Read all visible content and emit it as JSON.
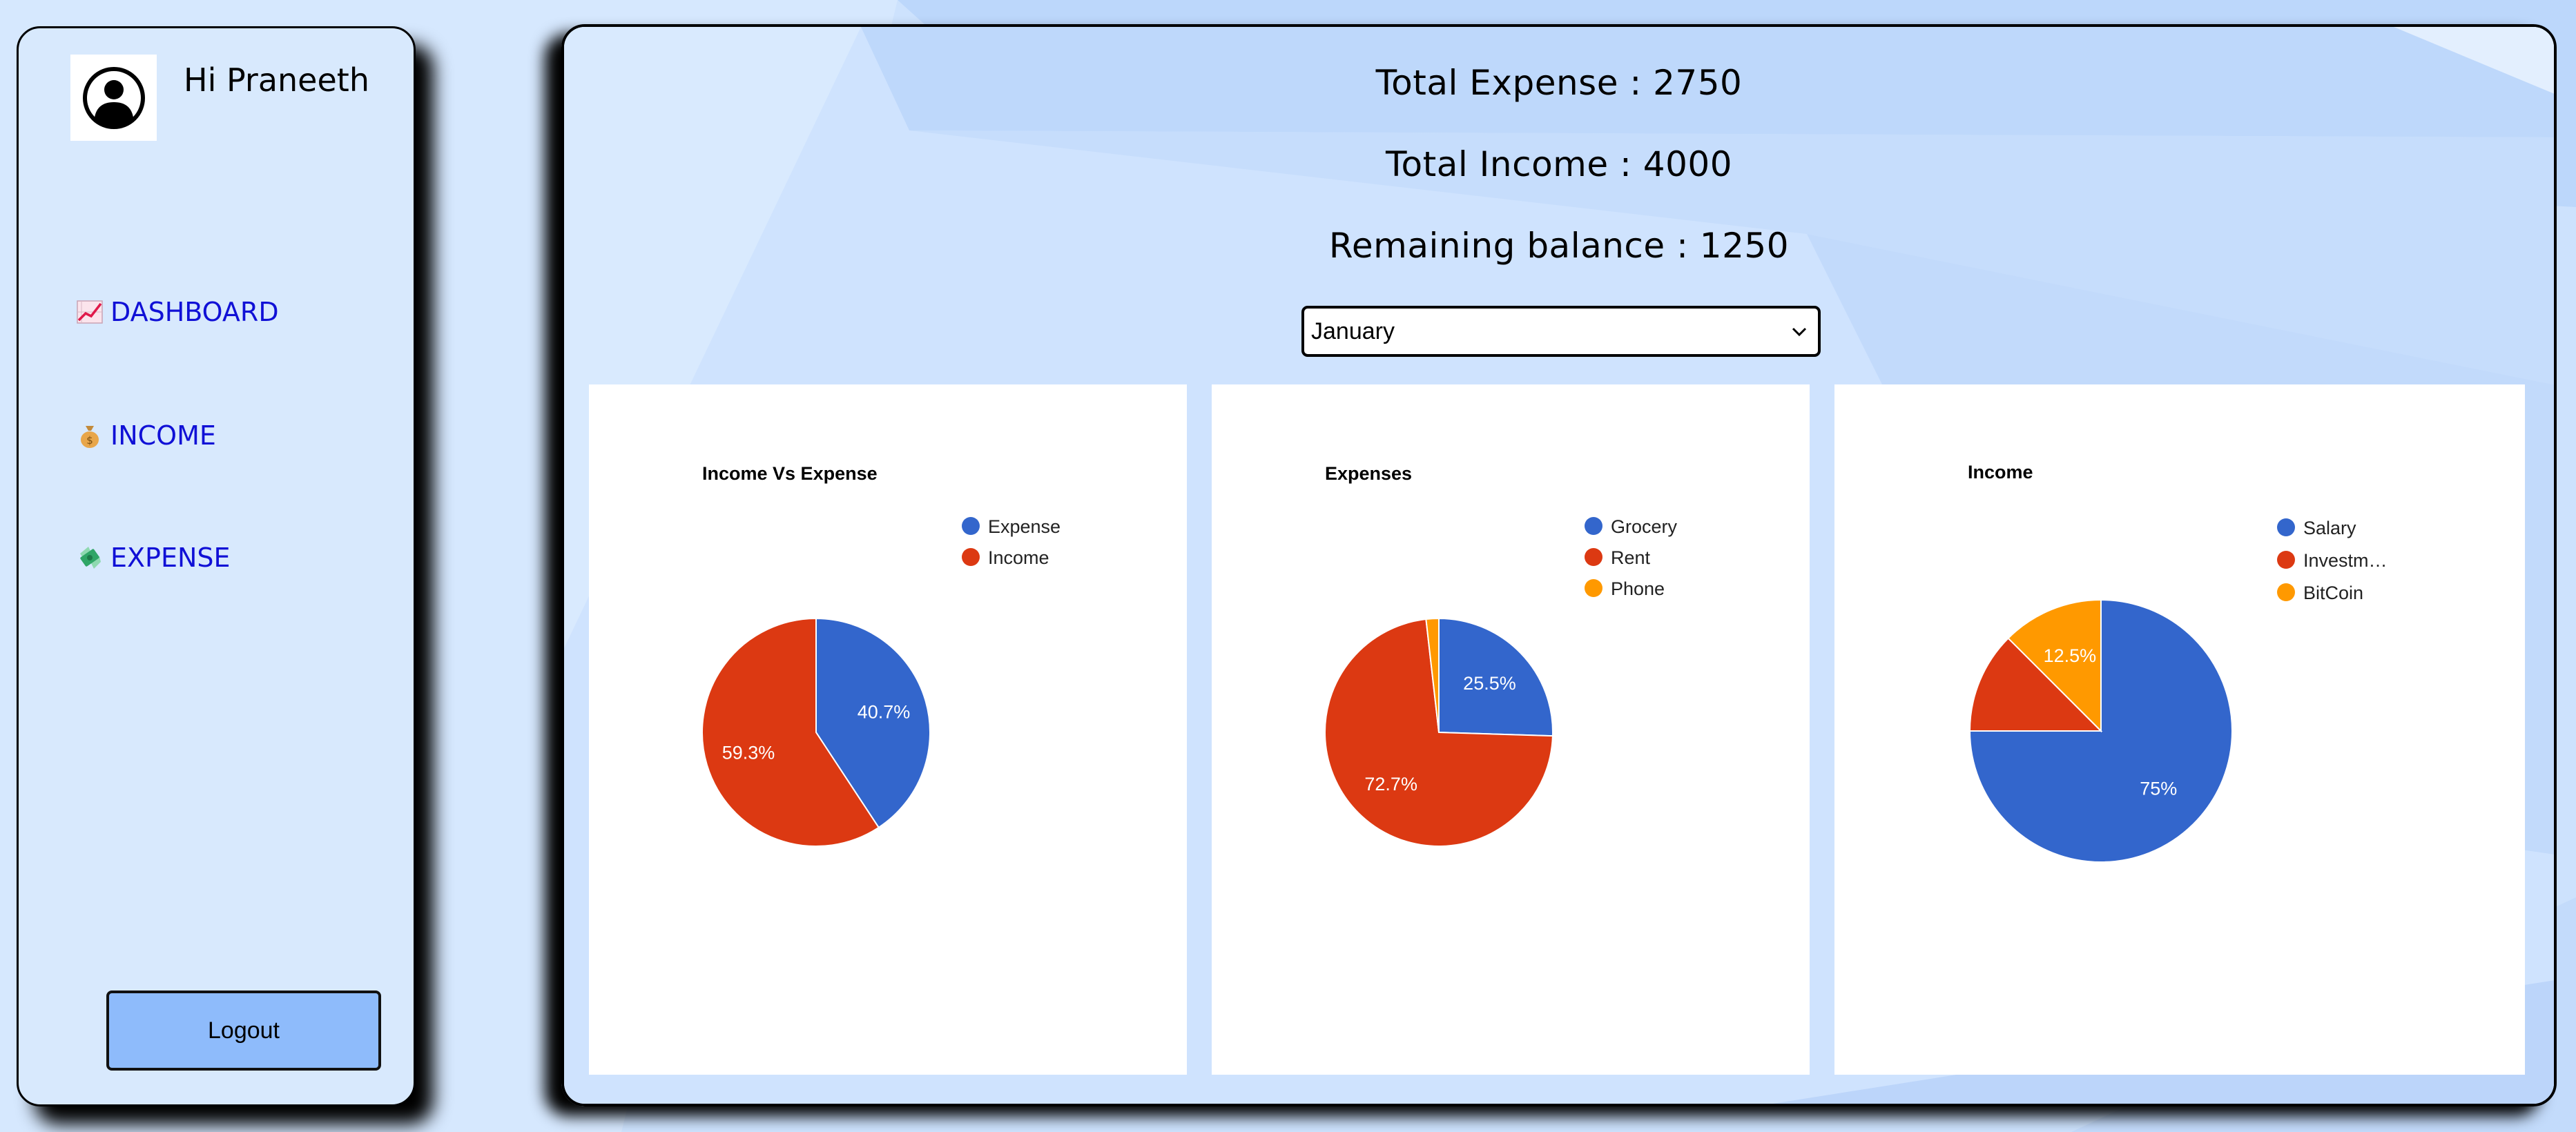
{
  "user": {
    "greeting": "Hi Praneeth"
  },
  "nav": [
    {
      "label": "DASHBOARD",
      "icon": "chart-increasing-icon"
    },
    {
      "label": "INCOME",
      "icon": "money-bag-icon"
    },
    {
      "label": "EXPENSE",
      "icon": "money-with-wings-icon"
    }
  ],
  "logout_label": "Logout",
  "summary": {
    "total_expense": "Total Expense : 2750",
    "total_income": "Total Income : 4000",
    "remaining_balance": "Remaining balance : 1250"
  },
  "month_select": {
    "value": "January"
  },
  "colors": {
    "blue": "#3366cc",
    "red": "#dc3912",
    "orange": "#ff9900",
    "button": "#8ebbfb"
  },
  "chart_data": [
    {
      "type": "pie",
      "title": "Income Vs Expense",
      "labels": [
        "Expense",
        "Income"
      ],
      "values": [
        2750,
        4000
      ],
      "percent_labels": [
        "40.7%",
        "59.3%"
      ],
      "colors": [
        "#3366cc",
        "#dc3912"
      ],
      "legend": "top-right"
    },
    {
      "type": "pie",
      "title": "Expenses",
      "labels": [
        "Grocery",
        "Rent",
        "Phone"
      ],
      "values": [
        25.5,
        72.7,
        1.8
      ],
      "percent_labels": [
        "25.5%",
        "72.7%",
        ""
      ],
      "colors": [
        "#3366cc",
        "#dc3912",
        "#ff9900"
      ],
      "legend": "top-right"
    },
    {
      "type": "pie",
      "title": "Income",
      "labels": [
        "Salary",
        "Investm…",
        "BitCoin"
      ],
      "values": [
        75,
        12.5,
        12.5
      ],
      "percent_labels": [
        "75%",
        "",
        "12.5%"
      ],
      "colors": [
        "#3366cc",
        "#dc3912",
        "#ff9900"
      ],
      "legend": "top-right"
    }
  ]
}
